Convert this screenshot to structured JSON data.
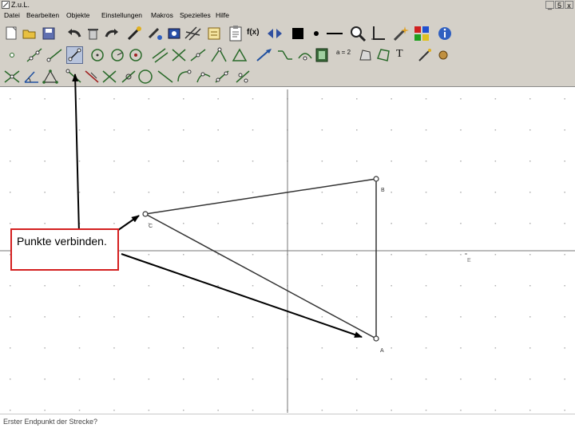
{
  "window": {
    "title": "Z.u.L.",
    "controls": {
      "minimize": "_",
      "maximize": "5",
      "close": "x"
    }
  },
  "menu": {
    "items": [
      "Datei",
      "Bearbeiten",
      "Objekte",
      "Einstellungen",
      "Makros",
      "Spezielles",
      "Hilfe"
    ]
  },
  "toolbar": {
    "fx_label": "f(x)",
    "ab_label": "a = 2",
    "text_tool_label": "T"
  },
  "construction": {
    "points": {
      "a": "A",
      "b": "B",
      "c": "C",
      "e": "E"
    }
  },
  "callout": {
    "text": "Punkte verbinden."
  },
  "status": {
    "text": "Erster Endpunkt der Strecke?"
  },
  "colors": {
    "callout_border": "#d42020",
    "chrome": "#d4d0c8",
    "selected_tool": "#b8c4dc"
  }
}
